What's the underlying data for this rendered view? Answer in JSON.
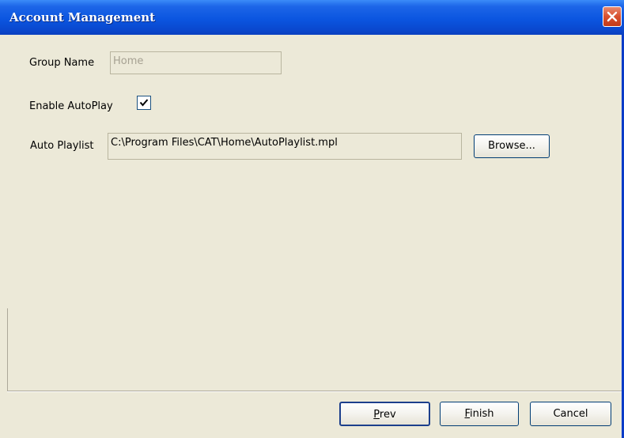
{
  "window": {
    "title": "Account Management"
  },
  "form": {
    "group_name": {
      "label": "Group Name",
      "value": "Home",
      "disabled": true
    },
    "enable_autoplay": {
      "label": "Enable AutoPlay",
      "checked": true
    },
    "auto_playlist": {
      "label": "Auto Playlist",
      "value": "C:\\Program Files\\CAT\\Home\\AutoPlaylist.mpl"
    },
    "browse_label": "Browse..."
  },
  "footer": {
    "prev": {
      "first": "P",
      "rest": "rev"
    },
    "finish": {
      "first": "F",
      "rest": "inish"
    },
    "cancel_label": "Cancel"
  },
  "icons": {
    "close": "close-icon",
    "check": "checkmark-icon"
  },
  "colors": {
    "titlebar": "#0b55e0",
    "close_button": "#d8502f",
    "dialog_background": "#ece9d8"
  }
}
